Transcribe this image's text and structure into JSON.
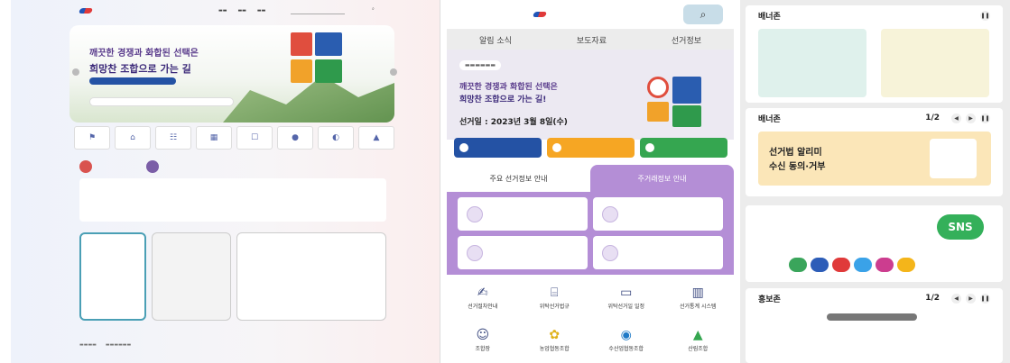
{
  "mobile": {
    "tabs": [
      "알림 소식",
      "보도자료",
      "선거정보"
    ],
    "hero": {
      "headline_1": "깨끗한 경쟁과 화합된 선택은",
      "headline_2": "희망찬 조합으로 가는 길!",
      "date": "선거일 : 2023년 3월 8일(수)"
    },
    "section_tabs": [
      "주요 선거정보 안내",
      "주거래정보 안내"
    ],
    "grid": [
      {
        "label": "선거절차안내",
        "icon": "ballot-icon"
      },
      {
        "label": "위탁선거법규",
        "icon": "law-icon"
      },
      {
        "label": "위탁선거일 일정",
        "icon": "calendar-icon"
      },
      {
        "label": "선거통계 시스템",
        "icon": "stats-icon"
      },
      {
        "label": "조합장",
        "icon": "person-icon"
      },
      {
        "label": "농업협동조합",
        "icon": "farm-icon"
      },
      {
        "label": "수산업협동조합",
        "icon": "fish-icon"
      },
      {
        "label": "산림조합",
        "icon": "forest-icon"
      }
    ],
    "colors": {
      "accent": "#b48ed6",
      "search": "#c8dde8",
      "chip1": "#2452a4",
      "chip2": "#f6a623",
      "chip3": "#35a650"
    }
  },
  "right": {
    "card1": {
      "title": "배너존"
    },
    "card2": {
      "title": "배너존",
      "page": "1/2",
      "banner_line1": "선거법 알리미",
      "banner_line2": "수신 동의·거부"
    },
    "card3": {
      "badge": "SNS"
    },
    "card4": {
      "title": "홍보존",
      "page": "1/2"
    },
    "controls": {
      "prev": "◀",
      "next": "▶",
      "pause": "❚❚"
    }
  },
  "desktop": {
    "banner_line1": "깨끗한 경쟁과 화합된 선택은",
    "banner_line2": "희망찬 조합으로 가는 길"
  }
}
